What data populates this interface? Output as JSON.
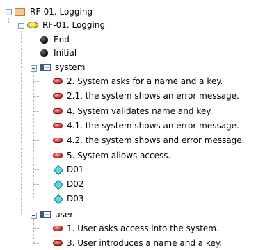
{
  "tree": {
    "package": {
      "label": "RF-01. Logging",
      "icon": "folder-icon"
    },
    "use_case": {
      "label": "RF-01. Logging",
      "icon": "use-case-icon"
    },
    "nodes": {
      "end": {
        "label": "End",
        "icon": "final-node-icon"
      },
      "initial": {
        "label": "Initial",
        "icon": "initial-node-icon"
      },
      "system": {
        "label": "system",
        "icon": "partition-icon",
        "actions": [
          "2. System asks for a name and a key.",
          "2.1. the system shows an error message.",
          "4. System validates name and key.",
          "4.1. the system shows an error message.",
          "4.2. the system shows and error message.",
          "5. System allows access."
        ],
        "decisions": [
          "D01",
          "D02",
          "D03"
        ]
      },
      "user": {
        "label": "user",
        "icon": "partition-icon",
        "actions": [
          "1. User asks access into the system.",
          "3. User introduces a name and a key."
        ]
      }
    }
  },
  "colors": {
    "folder": "#f2c896",
    "use_case": "#f2d43a",
    "action": "#e03a3a",
    "decision": "#4ee0e8",
    "partition": "#3a5a8a",
    "tree_line": "#b4b4b4"
  }
}
